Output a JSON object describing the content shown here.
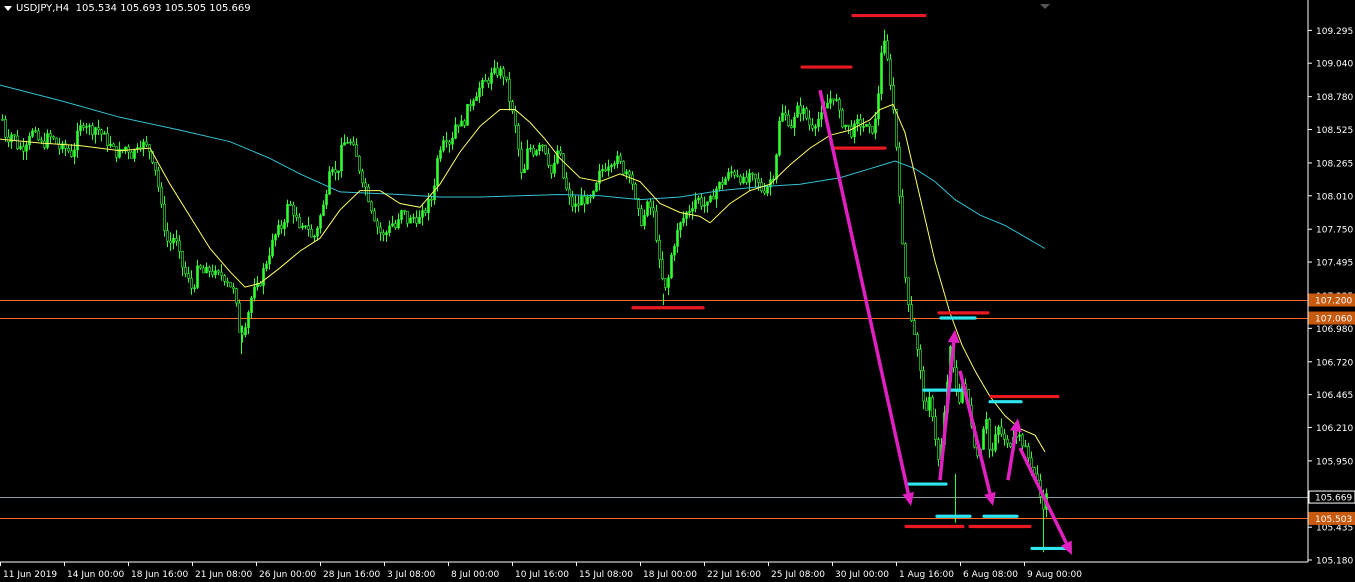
{
  "header": {
    "symbol": "USDJPY,H4",
    "ohlc": "105.534 105.693 105.505 105.669"
  },
  "colors": {
    "background": "#000000",
    "candle": "#33ff33",
    "ma_fast": "#ffff66",
    "ma_slow": "#33c3d6",
    "resistance": "#e8191f",
    "support": "#2ee6f0",
    "arrow": "#e020c0",
    "hline_orange": "#ff6a2a",
    "hline_gray": "#8a9aa8",
    "axis_text": "#ffffff",
    "price_tag": "#c85a10"
  },
  "chart_data": {
    "type": "candlestick",
    "symbol": "USDJPY",
    "timeframe": "H4",
    "ylim": [
      105.18,
      109.43
    ],
    "y_ticks": [
      "109.295",
      "109.040",
      "108.780",
      "108.525",
      "108.265",
      "108.010",
      "107.750",
      "107.495",
      "107.235",
      "106.980",
      "106.720",
      "106.465",
      "106.210",
      "105.950",
      "105.695",
      "105.435",
      "105.180"
    ],
    "x_ticks": [
      "11 Jun 2019",
      "14 Jun 00:00",
      "18 Jun 16:00",
      "21 Jun 08:00",
      "26 Jun 00:00",
      "28 Jun 16:00",
      "3 Jul 08:00",
      "8 Jul 00:00",
      "10 Jul 16:00",
      "15 Jul 08:00",
      "18 Jul 00:00",
      "22 Jul 16:00",
      "25 Jul 08:00",
      "30 Jul 00:00",
      "1 Aug 16:00",
      "6 Aug 08:00",
      "9 Aug 00:00"
    ],
    "price_tags": [
      {
        "label": "107.200",
        "value": 107.2,
        "kind": "orange"
      },
      {
        "label": "107.060",
        "value": 107.06,
        "kind": "orange"
      },
      {
        "label": "105.669",
        "value": 105.669,
        "kind": "gray"
      },
      {
        "label": "105.503",
        "value": 105.503,
        "kind": "orange"
      }
    ],
    "close_path": [
      [
        0,
        108.68
      ],
      [
        6,
        108.45
      ],
      [
        12,
        108.5
      ],
      [
        18,
        108.38
      ],
      [
        24,
        108.4
      ],
      [
        30,
        108.52
      ],
      [
        36,
        108.46
      ],
      [
        42,
        108.4
      ],
      [
        48,
        108.47
      ],
      [
        54,
        108.44
      ],
      [
        60,
        108.37
      ],
      [
        66,
        108.38
      ],
      [
        72,
        108.33
      ],
      [
        78,
        108.5
      ],
      [
        84,
        108.6
      ],
      [
        90,
        108.52
      ],
      [
        96,
        108.55
      ],
      [
        102,
        108.48
      ],
      [
        108,
        108.42
      ],
      [
        114,
        108.35
      ],
      [
        120,
        108.34
      ],
      [
        126,
        108.4
      ],
      [
        132,
        108.32
      ],
      [
        138,
        108.44
      ],
      [
        144,
        108.4
      ],
      [
        150,
        108.36
      ],
      [
        156,
        108.2
      ],
      [
        162,
        107.85
      ],
      [
        168,
        107.62
      ],
      [
        174,
        107.7
      ],
      [
        180,
        107.5
      ],
      [
        186,
        107.38
      ],
      [
        192,
        107.28
      ],
      [
        198,
        107.45
      ],
      [
        204,
        107.4
      ],
      [
        210,
        107.44
      ],
      [
        216,
        107.38
      ],
      [
        222,
        107.4
      ],
      [
        228,
        107.35
      ],
      [
        234,
        107.25
      ],
      [
        240,
        106.92
      ],
      [
        246,
        107.05
      ],
      [
        252,
        107.25
      ],
      [
        258,
        107.3
      ],
      [
        264,
        107.45
      ],
      [
        270,
        107.6
      ],
      [
        276,
        107.72
      ],
      [
        282,
        107.78
      ],
      [
        288,
        107.95
      ],
      [
        294,
        107.88
      ],
      [
        300,
        107.7
      ],
      [
        306,
        107.82
      ],
      [
        312,
        107.65
      ],
      [
        318,
        107.8
      ],
      [
        324,
        107.95
      ],
      [
        330,
        108.3
      ],
      [
        336,
        108.15
      ],
      [
        342,
        108.4
      ],
      [
        348,
        108.45
      ],
      [
        354,
        108.35
      ],
      [
        360,
        108.2
      ],
      [
        366,
        108.05
      ],
      [
        372,
        107.9
      ],
      [
        378,
        107.75
      ],
      [
        384,
        107.68
      ],
      [
        390,
        107.82
      ],
      [
        396,
        107.75
      ],
      [
        402,
        107.9
      ],
      [
        408,
        107.8
      ],
      [
        414,
        107.85
      ],
      [
        420,
        107.82
      ],
      [
        426,
        107.92
      ],
      [
        432,
        108.0
      ],
      [
        438,
        108.35
      ],
      [
        444,
        108.5
      ],
      [
        450,
        108.42
      ],
      [
        456,
        108.6
      ],
      [
        462,
        108.55
      ],
      [
        468,
        108.7
      ],
      [
        474,
        108.8
      ],
      [
        480,
        108.85
      ],
      [
        486,
        108.9
      ],
      [
        492,
        108.95
      ],
      [
        498,
        108.98
      ],
      [
        504,
        108.95
      ],
      [
        510,
        108.72
      ],
      [
        516,
        108.5
      ],
      [
        522,
        108.1
      ],
      [
        528,
        108.4
      ],
      [
        534,
        108.35
      ],
      [
        540,
        108.45
      ],
      [
        546,
        108.35
      ],
      [
        552,
        108.15
      ],
      [
        558,
        108.4
      ],
      [
        564,
        108.1
      ],
      [
        570,
        107.95
      ],
      [
        576,
        107.92
      ],
      [
        582,
        108.0
      ],
      [
        588,
        107.95
      ],
      [
        594,
        108.02
      ],
      [
        600,
        108.2
      ],
      [
        606,
        108.25
      ],
      [
        612,
        108.3
      ],
      [
        618,
        108.28
      ],
      [
        624,
        108.2
      ],
      [
        630,
        108.22
      ],
      [
        636,
        107.9
      ],
      [
        642,
        107.8
      ],
      [
        648,
        107.95
      ],
      [
        654,
        107.85
      ],
      [
        660,
        107.4
      ],
      [
        666,
        107.25
      ],
      [
        672,
        107.6
      ],
      [
        678,
        107.75
      ],
      [
        684,
        107.85
      ],
      [
        690,
        107.92
      ],
      [
        696,
        108.0
      ],
      [
        702,
        107.95
      ],
      [
        708,
        107.92
      ],
      [
        714,
        108.05
      ],
      [
        720,
        108.1
      ],
      [
        726,
        108.15
      ],
      [
        732,
        108.2
      ],
      [
        738,
        108.18
      ],
      [
        744,
        108.1
      ],
      [
        750,
        108.15
      ],
      [
        756,
        108.12
      ],
      [
        762,
        108.05
      ],
      [
        768,
        108.1
      ],
      [
        774,
        108.2
      ],
      [
        780,
        108.65
      ],
      [
        786,
        108.62
      ],
      [
        792,
        108.55
      ],
      [
        798,
        108.7
      ],
      [
        804,
        108.65
      ],
      [
        810,
        108.55
      ],
      [
        816,
        108.6
      ],
      [
        822,
        108.62
      ],
      [
        828,
        108.75
      ],
      [
        834,
        108.8
      ],
      [
        840,
        108.6
      ],
      [
        846,
        108.55
      ],
      [
        852,
        108.5
      ],
      [
        858,
        108.58
      ],
      [
        864,
        108.55
      ],
      [
        870,
        108.5
      ],
      [
        876,
        108.6
      ],
      [
        882,
        109.25
      ],
      [
        886,
        109.1
      ],
      [
        890,
        108.9
      ],
      [
        894,
        108.6
      ],
      [
        898,
        108.2
      ],
      [
        902,
        107.6
      ],
      [
        906,
        107.3
      ],
      [
        910,
        107.1
      ],
      [
        914,
        106.95
      ],
      [
        918,
        106.75
      ],
      [
        922,
        106.5
      ],
      [
        926,
        106.3
      ],
      [
        930,
        106.45
      ],
      [
        934,
        106.2
      ],
      [
        938,
        105.95
      ],
      [
        942,
        106.1
      ],
      [
        946,
        106.5
      ],
      [
        950,
        106.8
      ],
      [
        954,
        106.6
      ],
      [
        958,
        106.4
      ],
      [
        962,
        106.55
      ],
      [
        966,
        106.45
      ],
      [
        970,
        106.3
      ],
      [
        974,
        106.1
      ],
      [
        978,
        105.95
      ],
      [
        982,
        106.2
      ],
      [
        986,
        106.3
      ],
      [
        990,
        105.95
      ],
      [
        994,
        106.1
      ],
      [
        998,
        106.2
      ],
      [
        1002,
        106.15
      ],
      [
        1006,
        106.05
      ],
      [
        1010,
        106.1
      ],
      [
        1014,
        106.2
      ],
      [
        1018,
        106.15
      ],
      [
        1022,
        106.1
      ],
      [
        1026,
        106.0
      ],
      [
        1030,
        105.95
      ],
      [
        1034,
        105.85
      ],
      [
        1038,
        105.75
      ],
      [
        1042,
        105.6
      ],
      [
        1046,
        105.67
      ]
    ],
    "ma_fast_path": [
      [
        0,
        108.45
      ],
      [
        40,
        108.42
      ],
      [
        80,
        108.4
      ],
      [
        120,
        108.36
      ],
      [
        150,
        108.38
      ],
      [
        170,
        108.1
      ],
      [
        190,
        107.85
      ],
      [
        210,
        107.6
      ],
      [
        230,
        107.42
      ],
      [
        245,
        107.3
      ],
      [
        260,
        107.33
      ],
      [
        280,
        107.45
      ],
      [
        300,
        107.58
      ],
      [
        320,
        107.68
      ],
      [
        340,
        107.9
      ],
      [
        360,
        108.05
      ],
      [
        380,
        108.05
      ],
      [
        400,
        107.95
      ],
      [
        420,
        107.92
      ],
      [
        440,
        108.1
      ],
      [
        460,
        108.35
      ],
      [
        480,
        108.55
      ],
      [
        500,
        108.68
      ],
      [
        515,
        108.68
      ],
      [
        530,
        108.58
      ],
      [
        545,
        108.45
      ],
      [
        560,
        108.3
      ],
      [
        580,
        108.15
      ],
      [
        600,
        108.12
      ],
      [
        620,
        108.18
      ],
      [
        640,
        108.12
      ],
      [
        660,
        107.95
      ],
      [
        680,
        107.88
      ],
      [
        700,
        107.85
      ],
      [
        710,
        107.8
      ],
      [
        730,
        107.95
      ],
      [
        750,
        108.05
      ],
      [
        770,
        108.1
      ],
      [
        790,
        108.25
      ],
      [
        810,
        108.38
      ],
      [
        830,
        108.48
      ],
      [
        850,
        108.52
      ],
      [
        870,
        108.6
      ],
      [
        880,
        108.68
      ],
      [
        893,
        108.72
      ],
      [
        905,
        108.5
      ],
      [
        920,
        108.0
      ],
      [
        935,
        107.5
      ],
      [
        950,
        107.1
      ],
      [
        962,
        106.85
      ],
      [
        975,
        106.65
      ],
      [
        990,
        106.45
      ],
      [
        1005,
        106.3
      ],
      [
        1020,
        106.2
      ],
      [
        1035,
        106.15
      ],
      [
        1045,
        106.02
      ]
    ],
    "ma_slow_path": [
      [
        0,
        108.87
      ],
      [
        60,
        108.75
      ],
      [
        120,
        108.62
      ],
      [
        180,
        108.52
      ],
      [
        230,
        108.43
      ],
      [
        270,
        108.3
      ],
      [
        300,
        108.18
      ],
      [
        340,
        108.04
      ],
      [
        400,
        108.02
      ],
      [
        440,
        108.0
      ],
      [
        480,
        108.0
      ],
      [
        520,
        108.01
      ],
      [
        560,
        108.02
      ],
      [
        600,
        108.01
      ],
      [
        640,
        107.98
      ],
      [
        680,
        108.0
      ],
      [
        720,
        108.05
      ],
      [
        760,
        108.08
      ],
      [
        800,
        108.1
      ],
      [
        840,
        108.15
      ],
      [
        870,
        108.22
      ],
      [
        895,
        108.28
      ],
      [
        915,
        108.22
      ],
      [
        935,
        108.12
      ],
      [
        955,
        107.98
      ],
      [
        980,
        107.86
      ],
      [
        1005,
        107.78
      ],
      [
        1025,
        107.69
      ],
      [
        1045,
        107.6
      ]
    ],
    "resistance_lines": [
      {
        "x1": 853,
        "x2": 925,
        "y": 109.41
      },
      {
        "x1": 802,
        "x2": 851,
        "y": 109.01
      },
      {
        "x1": 833,
        "x2": 885,
        "y": 108.38
      },
      {
        "x1": 633,
        "x2": 703,
        "y": 107.14
      },
      {
        "x1": 939,
        "x2": 988,
        "y": 107.1
      },
      {
        "x1": 991,
        "x2": 1058,
        "y": 106.45
      },
      {
        "x1": 906,
        "x2": 963,
        "y": 105.44
      },
      {
        "x1": 970,
        "x2": 1030,
        "y": 105.44
      }
    ],
    "support_lines": [
      {
        "x1": 941,
        "x2": 975,
        "y": 107.06
      },
      {
        "x1": 924,
        "x2": 962,
        "y": 106.5
      },
      {
        "x1": 990,
        "x2": 1021,
        "y": 106.41
      },
      {
        "x1": 906,
        "x2": 946,
        "y": 105.77
      },
      {
        "x1": 937,
        "x2": 970,
        "y": 105.52
      },
      {
        "x1": 984,
        "x2": 1017,
        "y": 105.52
      },
      {
        "x1": 1032,
        "x2": 1070,
        "y": 105.27
      }
    ],
    "arrows": [
      {
        "x1": 820,
        "y1": 108.83,
        "x2": 911,
        "y2": 105.6
      },
      {
        "x1": 940,
        "y1": 105.8,
        "x2": 955,
        "y2": 106.97
      },
      {
        "x1": 960,
        "y1": 106.65,
        "x2": 993,
        "y2": 105.6
      },
      {
        "x1": 1008,
        "y1": 105.8,
        "x2": 1018,
        "y2": 106.28
      },
      {
        "x1": 1020,
        "y1": 106.05,
        "x2": 1072,
        "y2": 105.22
      }
    ]
  }
}
